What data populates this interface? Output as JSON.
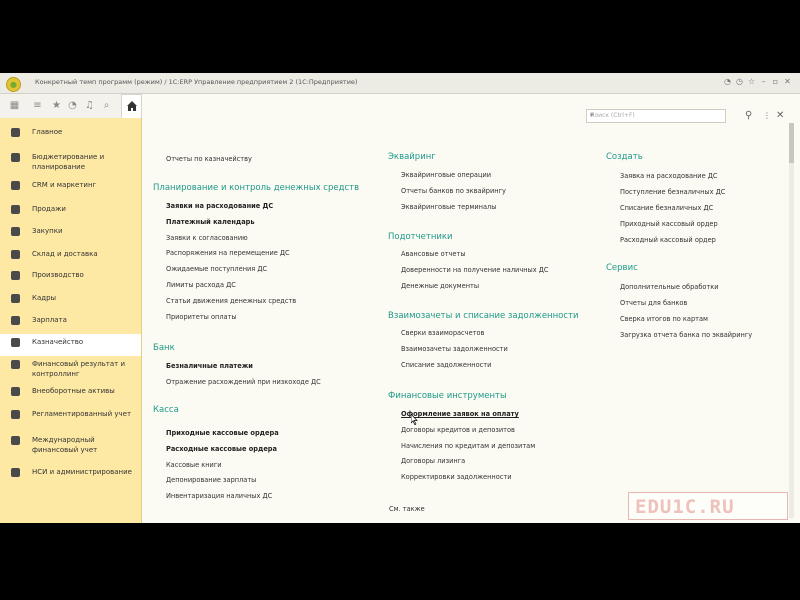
{
  "window": {
    "title": "Конкретный темп программ (режим) / 1С:ERP Управление предприятием 2 (1С:Предприятие)"
  },
  "search": {
    "placeholder": "Поиск (Ctrl+F)"
  },
  "sidebar": {
    "items": [
      {
        "label": "Главное",
        "icon": "menu-icon"
      },
      {
        "label": "Бюджетирование и планирование",
        "icon": "budget-icon"
      },
      {
        "label": "CRM и маркетинг",
        "icon": "crm-icon"
      },
      {
        "label": "Продажи",
        "icon": "cart-icon"
      },
      {
        "label": "Закупки",
        "icon": "truck-icon"
      },
      {
        "label": "Склад и доставка",
        "icon": "warehouse-icon"
      },
      {
        "label": "Производство",
        "icon": "factory-icon"
      },
      {
        "label": "Кадры",
        "icon": "people-icon"
      },
      {
        "label": "Зарплата",
        "icon": "payroll-icon"
      },
      {
        "label": "Казначейство",
        "icon": "treasury-icon"
      },
      {
        "label": "Финансовый результат и контроллинг",
        "icon": "chart-icon"
      },
      {
        "label": "Внеоборотные активы",
        "icon": "assets-icon"
      },
      {
        "label": "Регламентированный учет",
        "icon": "ledger-icon"
      },
      {
        "label": "Международный финансовый учет",
        "icon": "globe-icon"
      },
      {
        "label": "НСИ и администрирование",
        "icon": "gear-icon"
      }
    ],
    "active_label": "Казначейство"
  },
  "col1": {
    "top_link": "Отчеты по казначейству",
    "sections": [
      {
        "heading": "Планирование и контроль денежных средств",
        "links": [
          "Заявки на расходование ДС",
          "Платежный календарь",
          "Заявки к согласованию",
          "Распоряжения на перемещение ДС",
          "Ожидаемые поступления ДС",
          "Лимиты расхода ДС",
          "Статьи движения денежных средств",
          "Приоритеты оплаты"
        ]
      },
      {
        "heading": "Банк",
        "links": [
          "Безналичные платежи",
          "Отражение расхождений при низкоходе ДС"
        ]
      },
      {
        "heading": "Касса",
        "links": [
          "Приходные кассовые ордера",
          "Расходные кассовые ордера",
          "Кассовые книги",
          "Депонирование зарплаты",
          "Инвентаризация наличных ДС"
        ]
      }
    ]
  },
  "col2": {
    "sections": [
      {
        "heading": "Эквайринг",
        "links": [
          "Эквайринговые операции",
          "Отчеты банков по эквайрингу",
          "Эквайринговые терминалы"
        ]
      },
      {
        "heading": "Подотчетники",
        "links": [
          "Авансовые отчеты",
          "Доверенности на получение наличных ДС",
          "Денежные документы"
        ]
      },
      {
        "heading": "Взаимозачеты и списание задолженности",
        "links": [
          "Сверки взаиморасчетов",
          "Взаимозачеты задолженности",
          "Списание задолженности"
        ]
      },
      {
        "heading": "Финансовые инструменты",
        "links": [
          "Оформление заявок на оплату",
          "Договоры кредитов и депозитов",
          "Начисления по кредитам и депозитам",
          "Договоры лизинга",
          "Корректировки задолженности"
        ]
      }
    ],
    "see_also": "См. также"
  },
  "col3": {
    "sections": [
      {
        "heading": "Создать",
        "links": [
          "Заявка на расходование ДС",
          "Поступление безналичных ДС",
          "Списание безналичных ДС",
          "Приходный кассовый ордер",
          "Расходный кассовый ордер"
        ]
      },
      {
        "heading": "Сервис",
        "links": [
          "Дополнительные обработки",
          "Отчеты для банков",
          "Сверка итогов по картам",
          "Загрузка отчета банка по эквайрингу"
        ]
      }
    ]
  },
  "watermark": {
    "text": "EDU1C.RU"
  },
  "colors": {
    "accent": "#1e9a88",
    "sidebar_bg": "#fde9a4",
    "content_bg": "#fbfaf3"
  }
}
